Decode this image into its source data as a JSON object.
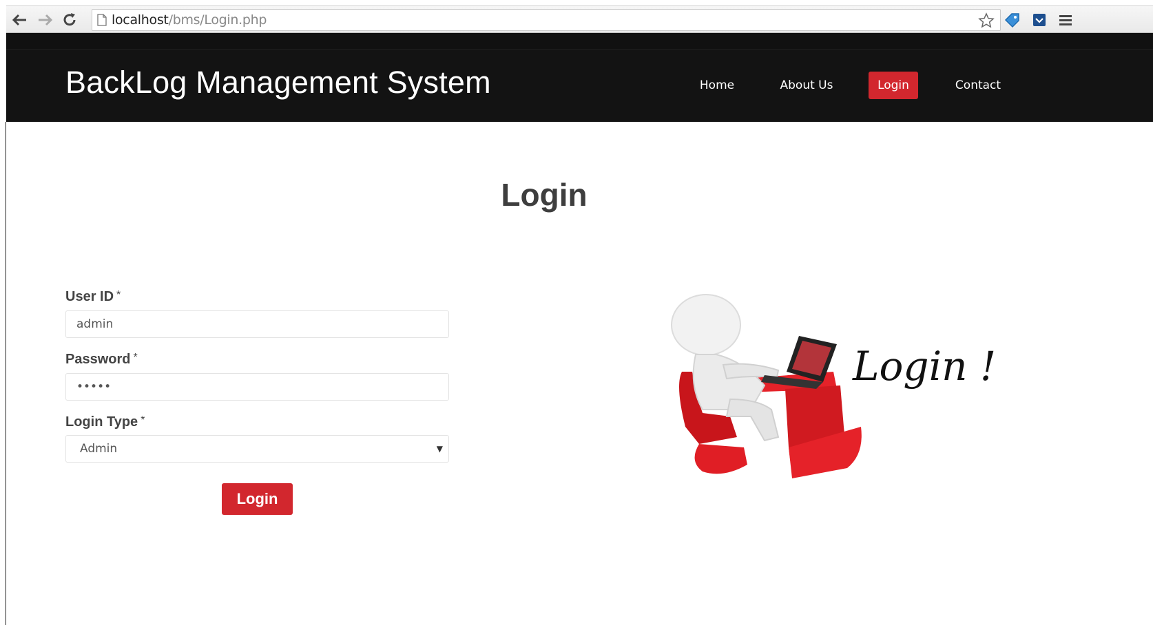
{
  "browser": {
    "url_host": "localhost",
    "url_path": "/bms/Login.php"
  },
  "site": {
    "brand": "BackLog Management System",
    "nav": [
      {
        "label": "Home",
        "active": false
      },
      {
        "label": "About Us",
        "active": false
      },
      {
        "label": "Login",
        "active": true
      },
      {
        "label": "Contact",
        "active": false
      }
    ]
  },
  "main": {
    "title": "Login",
    "form": {
      "user_id_label": "User ID",
      "user_id_value": "admin",
      "password_label": "Password",
      "password_value": "•••••",
      "login_type_label": "Login Type",
      "login_type_value": "Admin",
      "required_mark": "*",
      "submit_label": "Login"
    },
    "illustration_text": "Login !"
  },
  "colors": {
    "accent": "#d2272e",
    "header_bg": "#131313"
  }
}
